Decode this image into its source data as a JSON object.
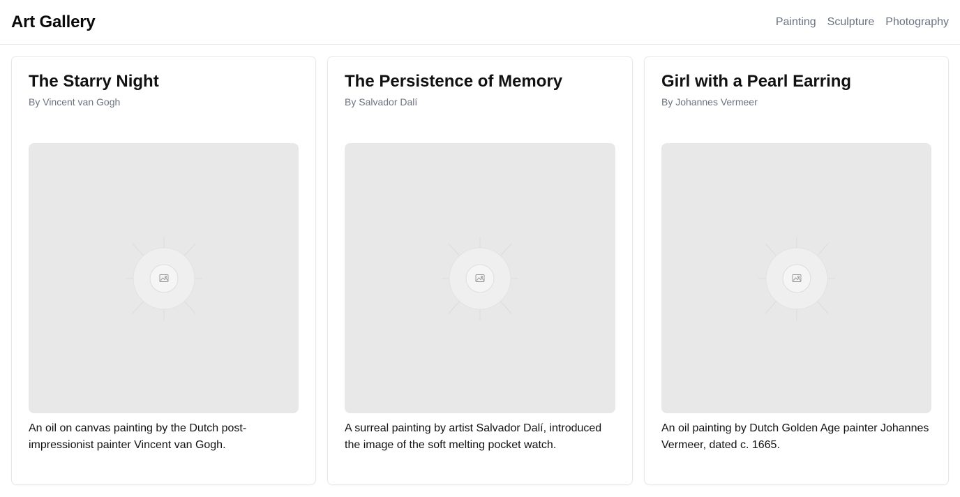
{
  "header": {
    "title": "Art Gallery",
    "nav": [
      "Painting",
      "Sculpture",
      "Photography"
    ]
  },
  "artworks": [
    {
      "title": "The Starry Night",
      "artist": "By Vincent van Gogh",
      "description": "An oil on canvas painting by the Dutch post-impressionist painter Vincent van Gogh.",
      "image_icon": "image-placeholder-icon"
    },
    {
      "title": "The Persistence of Memory",
      "artist": "By Salvador Dalí",
      "description": "A surreal painting by artist Salvador Dalí, introduced the image of the soft melting pocket watch.",
      "image_icon": "image-placeholder-icon"
    },
    {
      "title": "Girl with a Pearl Earring",
      "artist": "By Johannes Vermeer",
      "description": "An oil painting by Dutch Golden Age painter Johannes Vermeer, dated c. 1665.",
      "image_icon": "image-placeholder-icon"
    }
  ],
  "colors": {
    "muted_text": "#6b7280",
    "border": "#e5e7eb",
    "placeholder_bg": "#e8e8e8"
  }
}
